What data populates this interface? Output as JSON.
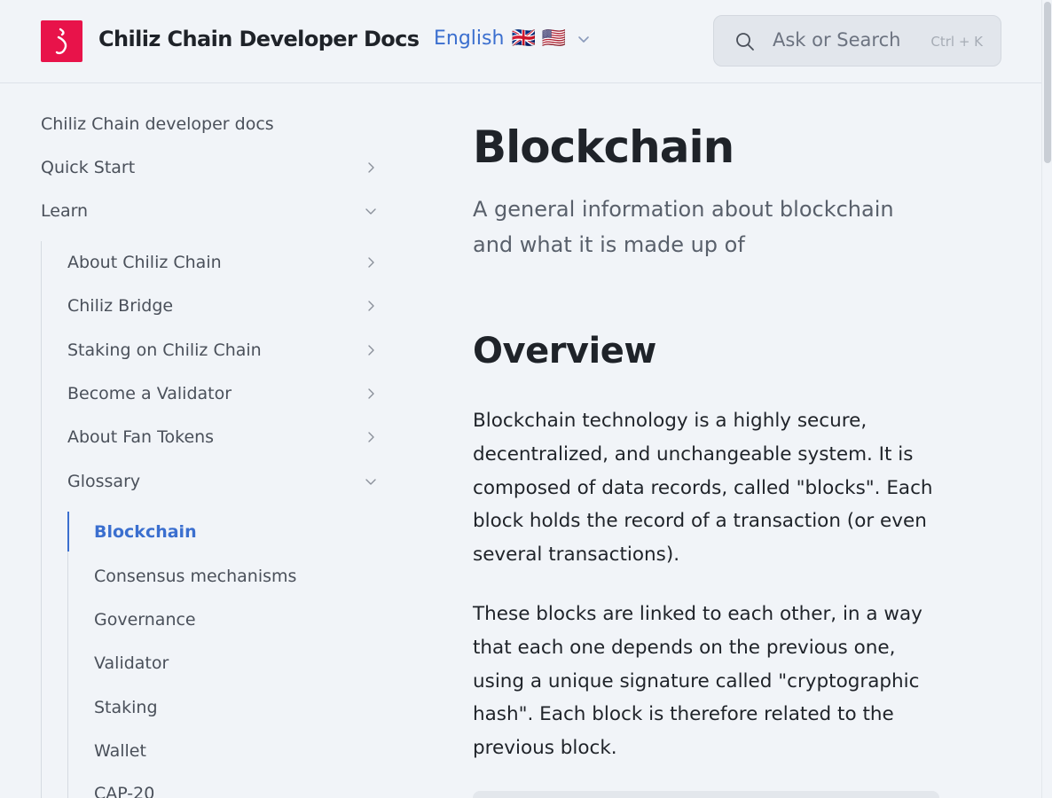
{
  "header": {
    "brand": "Chiliz Chain Developer Docs",
    "logo_icon": "chiliz-logo-icon",
    "brand_color": "#e8134a",
    "language": {
      "label": "English",
      "flags": "🇬🇧 🇺🇸"
    },
    "search": {
      "placeholder": "Ask or Search",
      "shortcut": "Ctrl + K"
    }
  },
  "sidebar": {
    "items": [
      {
        "label": "Chiliz Chain developer docs",
        "expandable": false
      },
      {
        "label": "Quick Start",
        "expandable": true,
        "expanded": false
      },
      {
        "label": "Learn",
        "expandable": true,
        "expanded": true
      },
      {
        "label": "About Chiliz Chain",
        "expandable": true,
        "expanded": false
      },
      {
        "label": "Chiliz Bridge",
        "expandable": true,
        "expanded": false
      },
      {
        "label": "Staking on Chiliz Chain",
        "expandable": true,
        "expanded": false
      },
      {
        "label": "Become a Validator",
        "expandable": true,
        "expanded": false
      },
      {
        "label": "About Fan Tokens",
        "expandable": true,
        "expanded": false
      },
      {
        "label": "Glossary",
        "expandable": true,
        "expanded": true
      },
      {
        "label": "Blockchain",
        "active": true
      },
      {
        "label": "Consensus mechanisms"
      },
      {
        "label": "Governance"
      },
      {
        "label": "Validator"
      },
      {
        "label": "Staking"
      },
      {
        "label": "Wallet"
      },
      {
        "label": "CAP-20"
      }
    ]
  },
  "main": {
    "title": "Blockchain",
    "subtitle": "A general information about blockchain and what it is made up of",
    "section_heading": "Overview",
    "paragraphs": [
      "Blockchain technology is a highly secure, decentralized, and unchangeable system. It is composed of data records, called \"blocks\". Each block holds the record of a transaction (or even several transactions).",
      "These blocks are linked to each other, in a way that each one depends on the previous one, using a unique signature called \"cryptographic hash\". Each block is therefore related to the previous block."
    ]
  },
  "colors": {
    "accent": "#3b6fcf",
    "background": "#f1f4f8",
    "text": "#1f2329",
    "muted": "#4a505a"
  }
}
